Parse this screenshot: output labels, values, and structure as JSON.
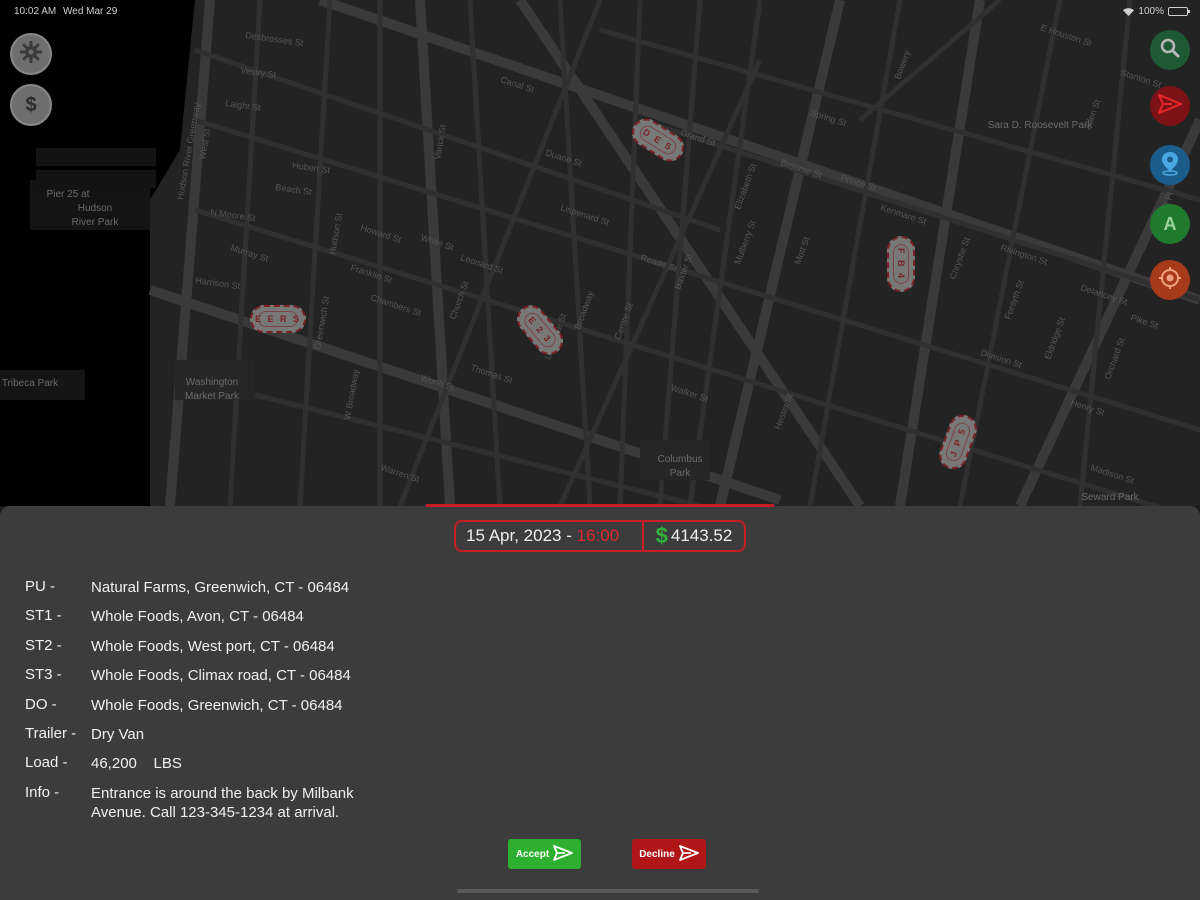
{
  "status_bar": {
    "time": "10:02 AM",
    "date": "Wed Mar 29",
    "battery": "100%"
  },
  "map": {
    "places": [
      "Pier 25 at",
      "Hudson",
      "River Park",
      "Washington",
      "Market Park",
      "Tribeca Park",
      "Columbus",
      "Park"
    ],
    "streets": [
      "Desbrosses St",
      "Vestry St",
      "Laight St",
      "Hubert St",
      "Beach St",
      "N Moore St",
      "Harrison St",
      "Franklin St",
      "White St",
      "Leonard St",
      "Worth St",
      "Thomas St",
      "Duane St",
      "Reade St",
      "Chambers St",
      "Warren St",
      "Murray St",
      "Canal St",
      "Grand St",
      "Broome St",
      "Spring St",
      "Prince St",
      "Lafayette St",
      "Centre St",
      "Baxter St",
      "Mulberry St",
      "Mott St",
      "Elizabeth St",
      "Bowery",
      "Chrystie St",
      "Forsyth St",
      "Eldridge St",
      "Allen St",
      "Orchard St",
      "Delancey St",
      "Rivington St",
      "Hester St",
      "Walker St",
      "Howard St",
      "Lispenard St",
      "Church St",
      "Greenwich St",
      "Hudson St",
      "Varick St",
      "W Broadway",
      "Broadway",
      "West St",
      "Hudson River Greenway",
      "E Houston St",
      "Kenmare St",
      "Stanton St",
      "Pike St",
      "Division St",
      "Henry St",
      "Madison St",
      "Baruch Pl"
    ],
    "labels_extra": [
      "Sara D. Roosevelt Park",
      "Seward Park"
    ],
    "cars": [
      "E E R S",
      "D E S",
      "E 2 3",
      "F B 4",
      "J P 5"
    ]
  },
  "fabs": {
    "left": [
      "settings-icon",
      "dollar-icon"
    ],
    "right": [
      "search-icon",
      "send-icon",
      "location-pin-icon",
      "letter-a-icon",
      "target-icon"
    ],
    "right_letter": "A",
    "dollar_glyph": "$",
    "colors": {
      "search": "#1f5a34",
      "send": "#7c1216",
      "pin": "#1a5c8c",
      "letter_a": "#1f7a2d",
      "target": "#a83a1c"
    }
  },
  "summary": {
    "date": "15 Apr, 2023 - ",
    "time": "16:00",
    "currency_symbol": "$",
    "price": "4143.52"
  },
  "details": [
    {
      "label": "PU -",
      "value": "Natural Farms, Greenwich, CT - 06484"
    },
    {
      "label": "ST1 -",
      "value": "Whole Foods, Avon, CT - 06484"
    },
    {
      "label": "ST2 -",
      "value": "Whole Foods, West port, CT - 06484"
    },
    {
      "label": "ST3 -",
      "value": "Whole Foods, Climax road, CT - 06484"
    },
    {
      "label": "DO -",
      "value": "Whole Foods, Greenwich, CT - 06484"
    },
    {
      "label": "Trailer -",
      "value": "Dry Van"
    },
    {
      "label": "Load -",
      "value": "46,200    LBS"
    },
    {
      "label": "Info -",
      "value": "Entrance is around the back by Milbank Avenue. Call 123-345-1234 at arrival."
    }
  ],
  "actions": {
    "accept_label": "Accept",
    "decline_label": "Decline"
  },
  "colors": {
    "accent_red": "#c61f26",
    "accept_green": "#2db02f",
    "decline_red": "#b01518",
    "sheet_bg": "#3c3c3c"
  }
}
